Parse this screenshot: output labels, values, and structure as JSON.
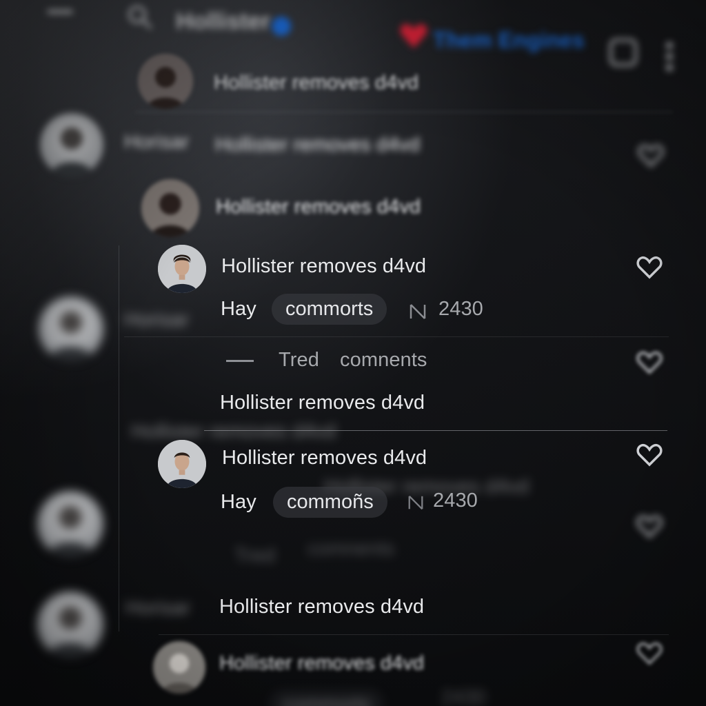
{
  "topbar": {
    "search_label": "Hollister",
    "right_text": "Them Engines"
  },
  "feed": {
    "title_text": "Hollister removes d4vd",
    "prefix_text": "Horisar",
    "reply_label": "Hay",
    "comments_pill_1": "commorts",
    "comments_pill_2": "commoñs",
    "count": "2430",
    "thread_label": "Tred",
    "thread_comments": "comnents"
  },
  "colors": {
    "verified_blue": "#1d6fe0",
    "heart_red": "#e0243a",
    "background": "#0d0e10"
  }
}
